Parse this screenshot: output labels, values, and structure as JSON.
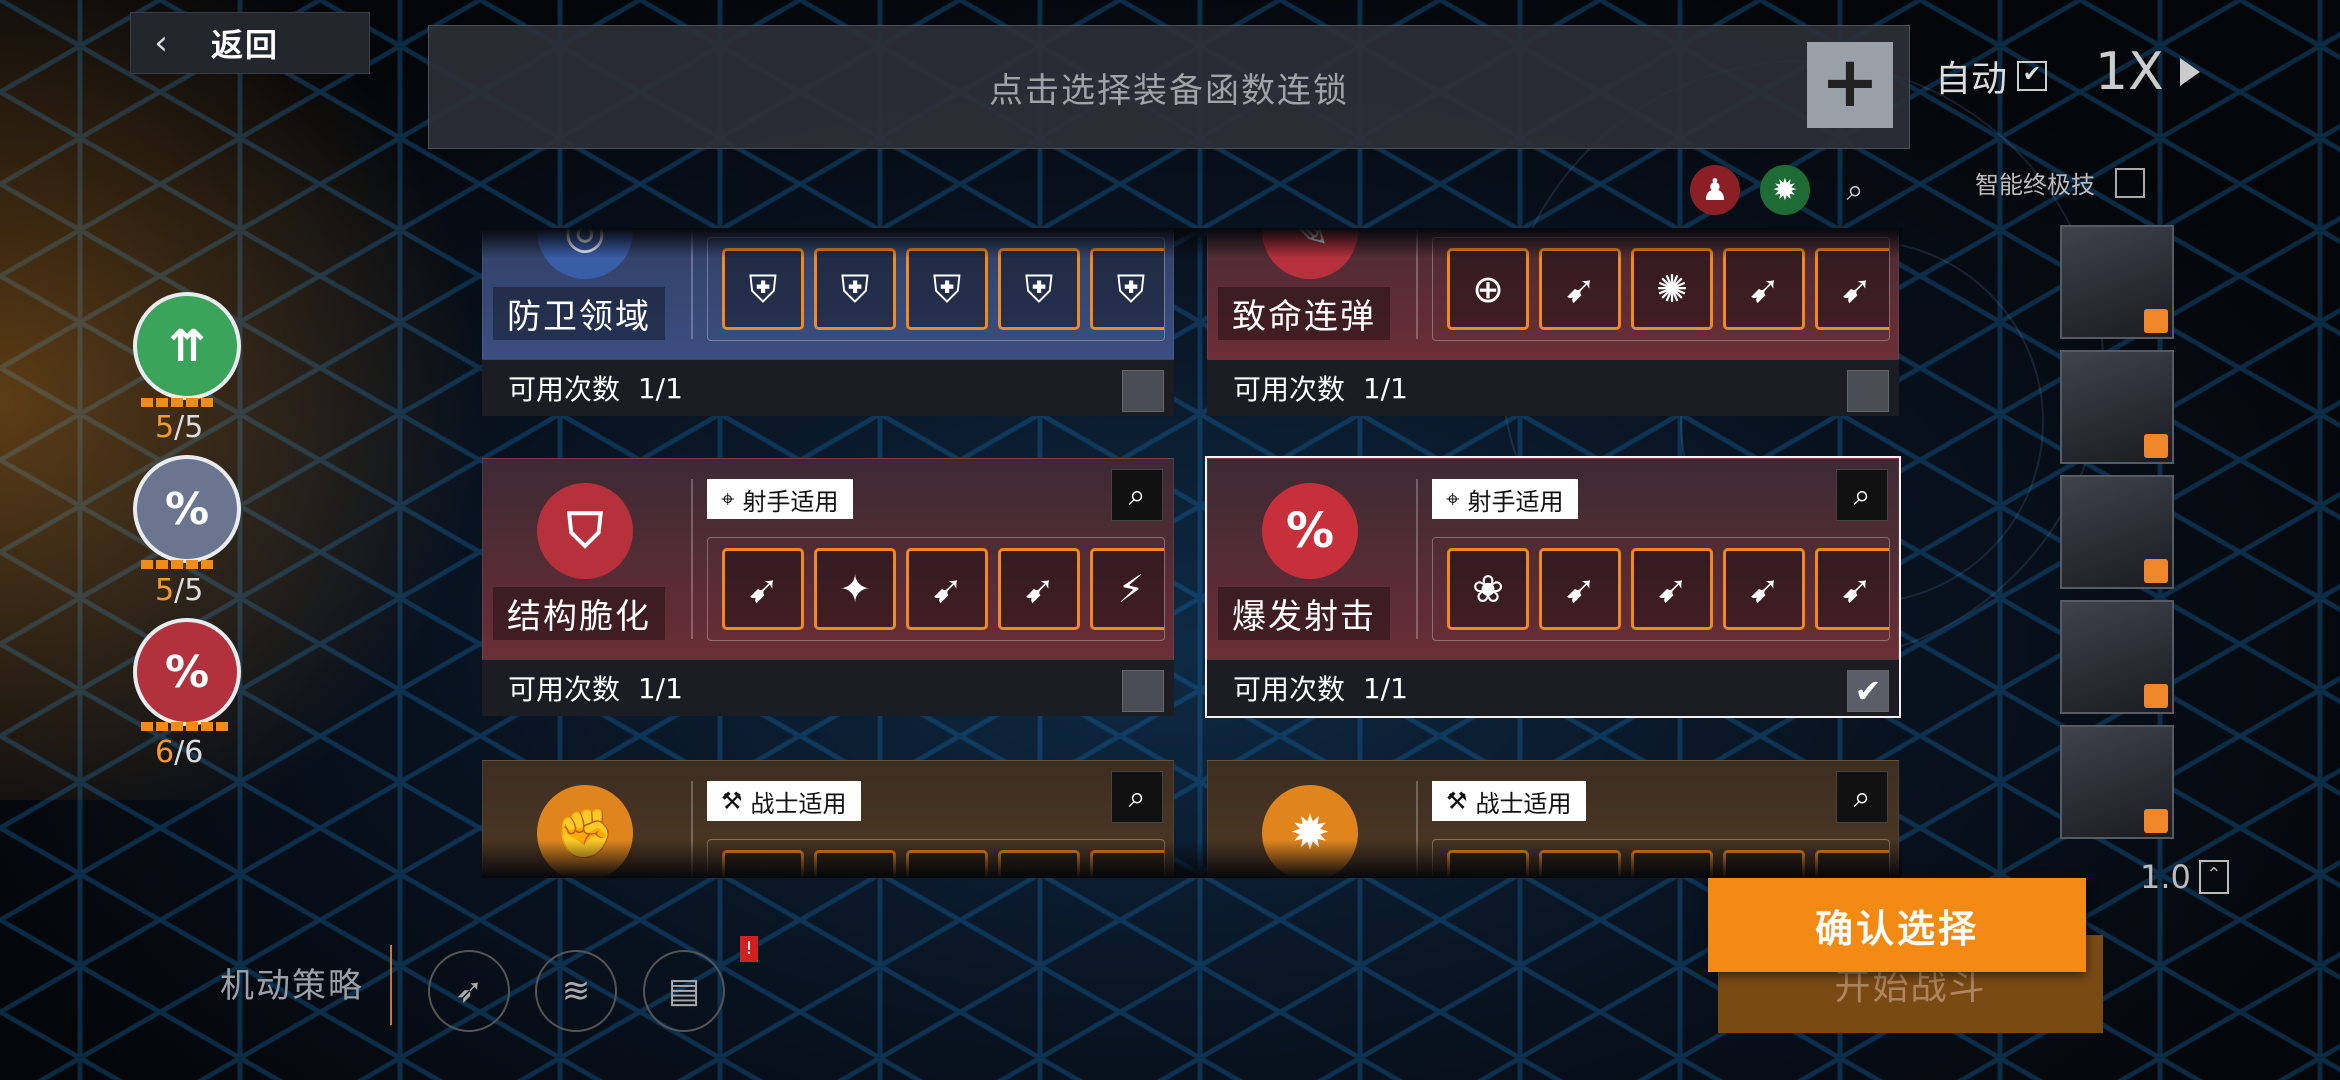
{
  "header": {
    "back_label": "返回",
    "chain_placeholder": "点击选择装备函数连锁",
    "chain_add": "+",
    "auto_label": "自动",
    "auto_checked": "✔",
    "speed_label": "1X",
    "smart_ult_label": "智能终极技"
  },
  "skills": [
    {
      "glyph": "⇈",
      "color": "#3aa55a",
      "used": "5",
      "total": "/5"
    },
    {
      "glyph": "%",
      "color": "#6a7690",
      "used": "5",
      "total": "/5"
    },
    {
      "glyph": "%",
      "color": "#b3313d",
      "used": "6",
      "total": "/6"
    }
  ],
  "cards": [
    {
      "name": "防卫领域",
      "theme": "blue",
      "emblem": "◎",
      "emblem_color": "#3a5da8",
      "tag": "",
      "uses_label": "可用次数",
      "uses": "1/1",
      "checked": "",
      "slots": [
        "⛨",
        "⛨",
        "⛨",
        "⛨",
        "⛨"
      ]
    },
    {
      "name": "致命连弹",
      "theme": "red",
      "emblem": "✎",
      "emblem_color": "#b7313c",
      "tag": "",
      "uses_label": "可用次数",
      "uses": "1/1",
      "checked": "",
      "slots": [
        "⊕",
        "➹",
        "✺",
        "➹",
        "➹"
      ]
    },
    {
      "name": "结构脆化",
      "theme": "red",
      "emblem": "⛉",
      "emblem_color": "#b7313c",
      "tag": "射手适用",
      "tag_icon": "⌖",
      "uses_label": "可用次数",
      "uses": "1/1",
      "checked": "",
      "slots": [
        "➹",
        "✦",
        "➹",
        "➹",
        "⚡"
      ]
    },
    {
      "name": "爆发射击",
      "theme": "red",
      "emblem": "%",
      "emblem_color": "#c72f3b",
      "tag": "射手适用",
      "tag_icon": "⌖",
      "uses_label": "可用次数",
      "uses": "1/1",
      "checked": "✔",
      "slots": [
        "❀",
        "➹",
        "➹",
        "➹",
        "➹"
      ]
    },
    {
      "name": "",
      "theme": "orange",
      "emblem": "✊",
      "emblem_color": "#e0851e",
      "tag": "战士适用",
      "tag_icon": "⚒",
      "uses_label": "",
      "uses": "",
      "checked": "",
      "slots": [
        "▪",
        "▪",
        "▪",
        "▪",
        "▪"
      ]
    },
    {
      "name": "",
      "theme": "orange",
      "emblem": "✹",
      "emblem_color": "#e0851e",
      "tag": "战士适用",
      "tag_icon": "⚒",
      "uses_label": "",
      "uses": "",
      "checked": "",
      "slots": [
        "▪",
        "▪",
        "▪",
        "▪",
        "▪"
      ]
    }
  ],
  "footer": {
    "strategy_label": "机动策略",
    "badge": "!",
    "start_label": "开始战斗",
    "confirm_label": "确认选择",
    "zoom_value": "1.0"
  }
}
